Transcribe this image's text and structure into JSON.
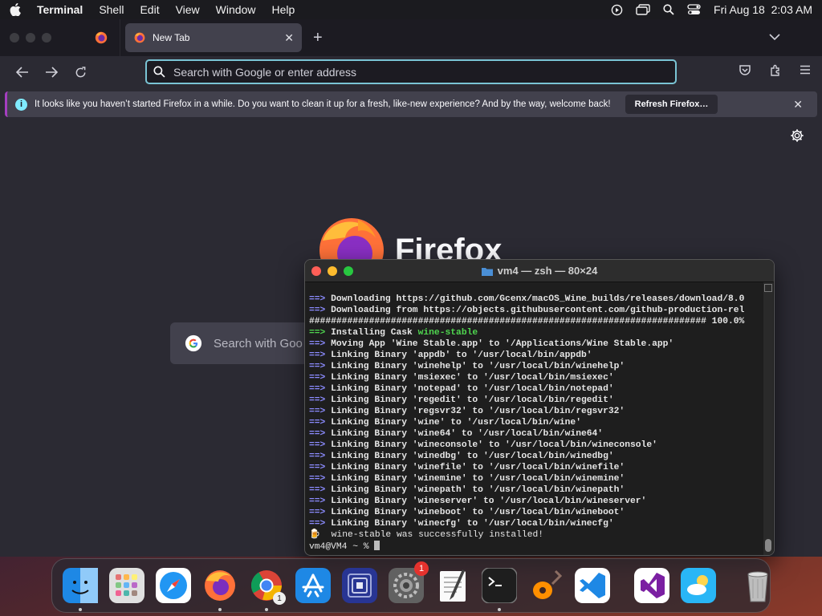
{
  "menubar": {
    "app_name": "Terminal",
    "items": [
      "Shell",
      "Edit",
      "View",
      "Window",
      "Help"
    ],
    "datetime": "Fri Aug 18  2:03 AM"
  },
  "firefox": {
    "tab_title": "New Tab",
    "url_placeholder": "Search with Google or enter address",
    "infobar_message": "It looks like you haven’t started Firefox in a while. Do you want to clean it up for a fresh, like-new experience? And by the way, welcome back!",
    "refresh_button": "Refresh Firefox…",
    "wordmark": "Firefox",
    "search_placeholder": "Search with Goo"
  },
  "terminal": {
    "title": "vm4 — zsh — 80×24",
    "lines": [
      {
        "prefix": "==>",
        "text": " Downloading https://github.com/Gcenx/macOS_Wine_builds/releases/download/8.0"
      },
      {
        "prefix": "==>",
        "text": " Downloading from https://objects.githubusercontent.com/github-production-rel"
      },
      {
        "prefix": "",
        "text": "######################################################################### 100.0%"
      },
      {
        "prefix": "==>",
        "green_prefix": true,
        "text": " Installing Cask ",
        "highlight": "wine-stable"
      },
      {
        "prefix": "==>",
        "text": " Moving App 'Wine Stable.app' to '/Applications/Wine Stable.app'"
      },
      {
        "prefix": "==>",
        "text": " Linking Binary 'appdb' to '/usr/local/bin/appdb'"
      },
      {
        "prefix": "==>",
        "text": " Linking Binary 'winehelp' to '/usr/local/bin/winehelp'"
      },
      {
        "prefix": "==>",
        "text": " Linking Binary 'msiexec' to '/usr/local/bin/msiexec'"
      },
      {
        "prefix": "==>",
        "text": " Linking Binary 'notepad' to '/usr/local/bin/notepad'"
      },
      {
        "prefix": "==>",
        "text": " Linking Binary 'regedit' to '/usr/local/bin/regedit'"
      },
      {
        "prefix": "==>",
        "text": " Linking Binary 'regsvr32' to '/usr/local/bin/regsvr32'"
      },
      {
        "prefix": "==>",
        "text": " Linking Binary 'wine' to '/usr/local/bin/wine'"
      },
      {
        "prefix": "==>",
        "text": " Linking Binary 'wine64' to '/usr/local/bin/wine64'"
      },
      {
        "prefix": "==>",
        "text": " Linking Binary 'wineconsole' to '/usr/local/bin/wineconsole'"
      },
      {
        "prefix": "==>",
        "text": " Linking Binary 'winedbg' to '/usr/local/bin/winedbg'"
      },
      {
        "prefix": "==>",
        "text": " Linking Binary 'winefile' to '/usr/local/bin/winefile'"
      },
      {
        "prefix": "==>",
        "text": " Linking Binary 'winemine' to '/usr/local/bin/winemine'"
      },
      {
        "prefix": "==>",
        "text": " Linking Binary 'winepath' to '/usr/local/bin/winepath'"
      },
      {
        "prefix": "==>",
        "text": " Linking Binary 'wineserver' to '/usr/local/bin/wineserver'"
      },
      {
        "prefix": "==>",
        "text": " Linking Binary 'wineboot' to '/usr/local/bin/wineboot'"
      },
      {
        "prefix": "==>",
        "text": " Linking Binary 'winecfg' to '/usr/local/bin/winecfg'"
      },
      {
        "prefix": "🍺",
        "text": "  wine-stable was successfully installed!",
        "normal": true
      }
    ],
    "prompt": "vm4@VM4 ~ % "
  },
  "dock": {
    "apps": [
      {
        "name": "Finder",
        "icon": "finder-icon",
        "color": "#1e88e5",
        "running": true
      },
      {
        "name": "Launchpad",
        "icon": "launchpad-icon",
        "color": "#9e9e9e",
        "running": false
      },
      {
        "name": "Safari",
        "icon": "safari-icon",
        "color": "#2196f3",
        "running": false
      },
      {
        "name": "Firefox",
        "icon": "firefox-icon",
        "color": "#ff7139",
        "running": true
      },
      {
        "name": "Google Chrome",
        "icon": "chrome-icon",
        "color": "#ffffff",
        "running": true,
        "sub_badge": "1"
      },
      {
        "name": "App Store",
        "icon": "appstore-icon",
        "color": "#1e88e5",
        "running": false
      },
      {
        "name": "Overflow",
        "icon": "overflow-icon",
        "color": "#3949ab",
        "running": false
      },
      {
        "name": "System Settings",
        "icon": "settings-icon",
        "color": "#757575",
        "running": false,
        "badge": "1"
      },
      {
        "name": "TextEdit",
        "icon": "textedit-icon",
        "color": "#f5f5f5",
        "running": false
      },
      {
        "name": "Terminal",
        "icon": "terminal-icon",
        "color": "#1e1e1e",
        "running": true
      },
      {
        "name": "GarageBand",
        "icon": "guitar-icon",
        "color": "#3e2723",
        "running": false
      },
      {
        "name": "Visual Studio Code",
        "icon": "vscode-icon",
        "color": "#ffffff",
        "running": false
      },
      {
        "name": "Visual Studio",
        "icon": "visualstudio-icon",
        "color": "#ffffff",
        "running": false
      },
      {
        "name": "Weather",
        "icon": "weather-icon",
        "color": "#29b6f6",
        "running": false
      },
      {
        "name": "Trash",
        "icon": "trash-icon",
        "color": "#9e9e9e",
        "running": false
      }
    ]
  }
}
